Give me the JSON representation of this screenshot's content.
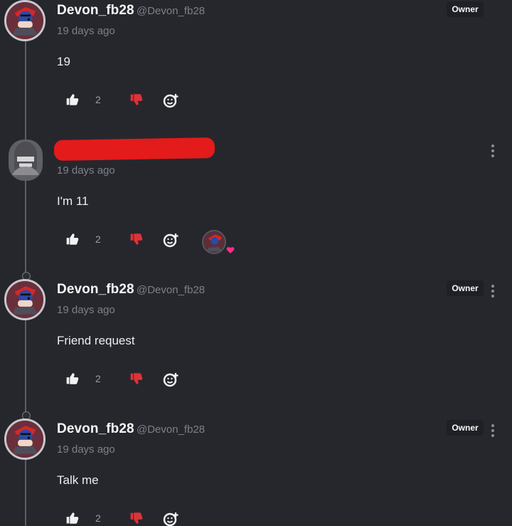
{
  "comments": [
    {
      "author": "Devon_fb28",
      "handle": "@Devon_fb28",
      "badge": "Owner",
      "time": "19 days ago",
      "text": "19",
      "likes": "2"
    },
    {
      "author": "",
      "handle": "",
      "badge": "",
      "time": "19 days ago",
      "text": "I'm 11",
      "likes": "2"
    },
    {
      "author": "Devon_fb28",
      "handle": "@Devon_fb28",
      "badge": "Owner",
      "time": "19 days ago",
      "text": "Friend request",
      "likes": "2"
    },
    {
      "author": "Devon_fb28",
      "handle": "@Devon_fb28",
      "badge": "Owner",
      "time": "19 days ago",
      "text": "Talk me",
      "likes": "2"
    }
  ],
  "colors": {
    "background": "#26272d",
    "dislike": "#e03138",
    "heart": "#ff2d8d",
    "redaction": "#e31b1b"
  },
  "icons": {
    "like": "thumbs-up-icon",
    "dislike": "thumbs-down-icon",
    "react": "add-reaction-icon",
    "menu": "more-vertical-icon"
  }
}
